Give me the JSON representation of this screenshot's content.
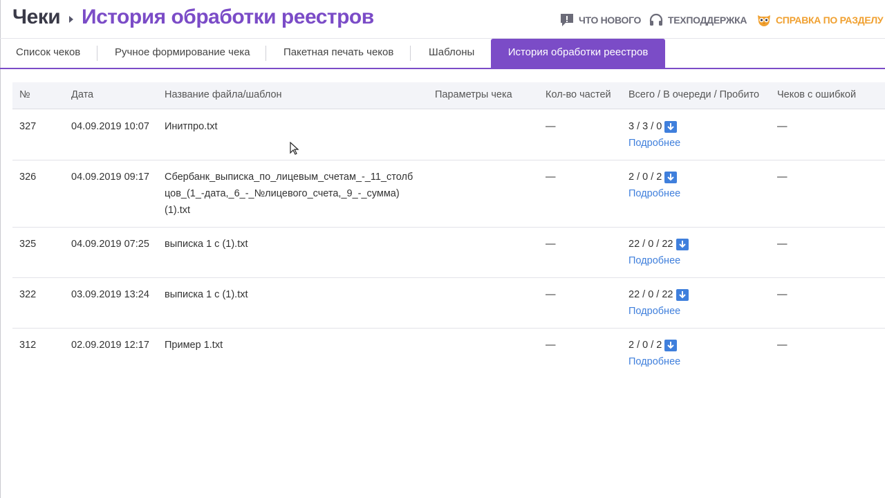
{
  "header": {
    "breadcrumb_root": "Чеки",
    "page_title": "История обработки реестров",
    "links": {
      "whats_new": "ЧТО НОВОГО",
      "support": "ТЕХПОДДЕРЖКА",
      "help": "СПРАВКА ПО РАЗДЕЛУ"
    }
  },
  "tabs": [
    {
      "label": "Список чеков"
    },
    {
      "label": "Ручное формирование чека"
    },
    {
      "label": "Пакетная печать чеков"
    },
    {
      "label": "Шаблоны"
    },
    {
      "label": "История обработки реестров",
      "active": true
    }
  ],
  "table": {
    "columns": [
      "№",
      "Дата",
      "Название файла/шаблон",
      "Параметры чека",
      "Кол-во частей",
      "Всего / В очереди / Пробито",
      "Чеков с ошибкой"
    ],
    "rows": [
      {
        "num": "327",
        "date": "04.09.2019 10:07",
        "file": "Инитпро.txt",
        "params": "",
        "parts": "—",
        "totals": "3 / 3 / 0",
        "more": "Подробнее",
        "errors": "—"
      },
      {
        "num": "326",
        "date": "04.09.2019 09:17",
        "file": "Сбербанк_выписка_по_лицевым_счетам_-_11_столбцов_(1_-дата,_6_-_№лицевого_счета,_9_-_сумма) (1).txt",
        "params": "",
        "parts": "—",
        "totals": "2 / 0 / 2",
        "more": "Подробнее",
        "errors": "—"
      },
      {
        "num": "325",
        "date": "04.09.2019 07:25",
        "file": "выписка 1 с (1).txt",
        "params": "",
        "parts": "—",
        "totals": "22 / 0 / 22",
        "more": "Подробнее",
        "errors": "—"
      },
      {
        "num": "322",
        "date": "03.09.2019 13:24",
        "file": "выписка 1 с (1).txt",
        "params": "",
        "parts": "—",
        "totals": "22 / 0 / 22",
        "more": "Подробнее",
        "errors": "—"
      },
      {
        "num": "312",
        "date": "02.09.2019 12:17",
        "file": "Пример 1.txt",
        "params": "",
        "parts": "—",
        "totals": "2 / 0 / 2",
        "more": "Подробнее",
        "errors": "—"
      }
    ]
  },
  "icons": {
    "whats_new": "exclamation-bubble-icon",
    "support": "headset-icon",
    "help": "owl-icon",
    "download": "download-icon"
  },
  "colors": {
    "accent": "#7b4cc7",
    "link": "#3f7fdc",
    "help": "#f0a030"
  }
}
